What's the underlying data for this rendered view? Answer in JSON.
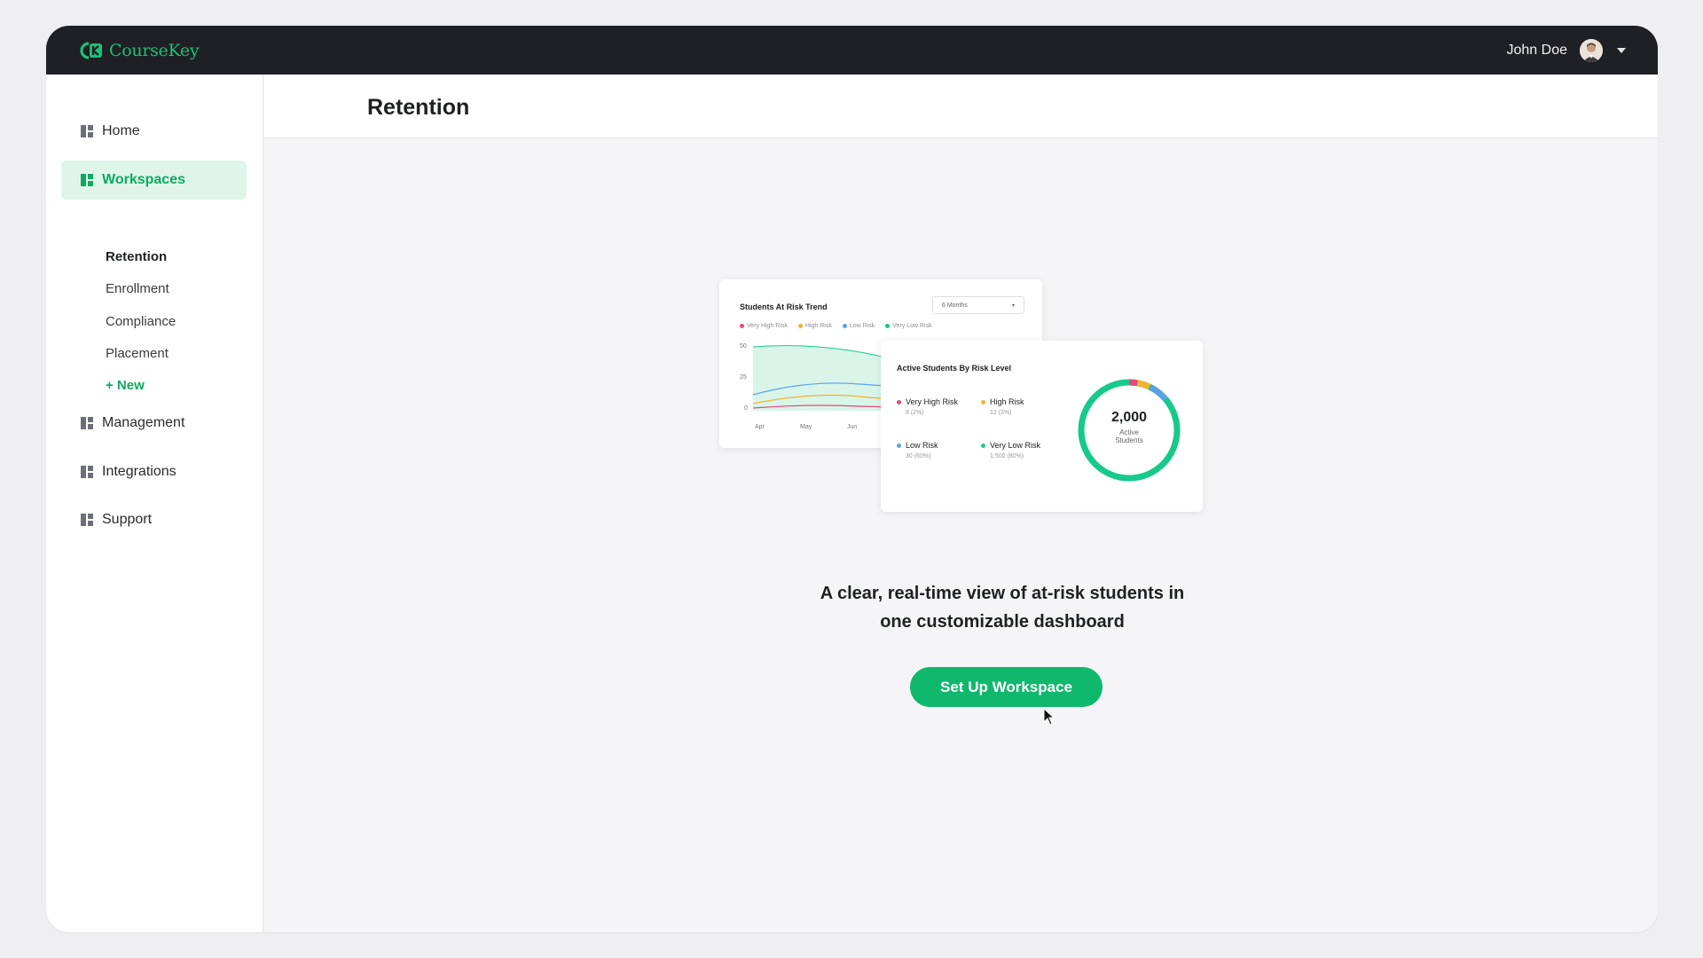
{
  "brand": {
    "name": "CourseKey",
    "color": "#1fbf7a"
  },
  "user": {
    "name": "John Doe"
  },
  "sidebar": {
    "items": [
      {
        "label": "Home",
        "icon": "grid-icon"
      },
      {
        "label": "Workspaces",
        "icon": "grid-icon",
        "active": true
      },
      {
        "label": "Management",
        "icon": "grid-icon"
      },
      {
        "label": "Integrations",
        "icon": "grid-icon"
      },
      {
        "label": "Support",
        "icon": "grid-icon"
      }
    ],
    "workspaces": [
      {
        "label": "Retention",
        "active": true
      },
      {
        "label": "Enrollment"
      },
      {
        "label": "Compliance"
      },
      {
        "label": "Placement"
      },
      {
        "label": "+ New"
      }
    ]
  },
  "page": {
    "title": "Retention"
  },
  "preview": {
    "trend_card": {
      "title": "Students At Risk Trend",
      "period": "6 Months",
      "legend": [
        "Very High Risk",
        "High Risk",
        "Low Risk",
        "Very Low Risk"
      ],
      "y_ticks": [
        "50",
        "25",
        "0"
      ],
      "x_ticks": [
        "Apr",
        "May",
        "Jun"
      ]
    },
    "level_card": {
      "title": "Active Students By Risk Level",
      "risks": [
        {
          "label": "Very High Risk",
          "value": "8 (2%)",
          "color": "#e5487a"
        },
        {
          "label": "High Risk",
          "value": "12 (3%)",
          "color": "#f2b234"
        },
        {
          "label": "Low Risk",
          "value": "30 (60%)",
          "color": "#5aa2e6"
        },
        {
          "label": "Very Low Risk",
          "value": "1,500 (80%)",
          "color": "#17c98a"
        }
      ],
      "total": "2,000",
      "total_label_1": "Active",
      "total_label_2": "Students"
    }
  },
  "main": {
    "tagline_line1": "A clear, real-time view of at-risk students in",
    "tagline_line2": "one customizable dashboard",
    "cta_label": "Set Up Workspace"
  }
}
